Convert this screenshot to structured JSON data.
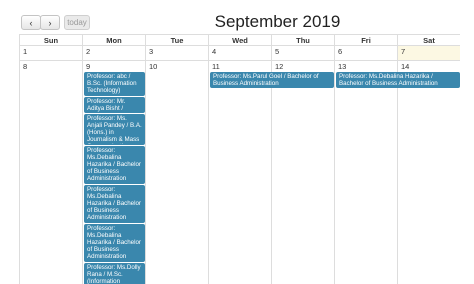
{
  "toolbar": {
    "prev_label": "‹",
    "next_label": "›",
    "today_label": "today",
    "title": "September 2019"
  },
  "weekdays": [
    "Sun",
    "Mon",
    "Tue",
    "Wed",
    "Thu",
    "Fri",
    "Sat"
  ],
  "week1": [
    "1",
    "2",
    "3",
    "4",
    "5",
    "6",
    "7"
  ],
  "week2": [
    "8",
    "9",
    "10",
    "11",
    "12",
    "13",
    "14"
  ],
  "events": {
    "mon": [
      "Professor: abc / B.Sc. (Information Technology)",
      "Professor: Mr. Aditya Bisht / B.H.M.",
      "Professor: Ms. Anjali Pandey / B.A. (Hons.) in Journalism & Mass Communication",
      "Professor: Ms.Debalina Hazarika / Bachelor of Business Administration",
      "Professor: Ms.Debalina Hazarika / Bachelor of Business Administration",
      "Professor: Ms.Debalina Hazarika / Bachelor of Business Administration",
      "Professor: Ms.Dolly Rana / M.Sc. (Information"
    ],
    "thu": "Professor: Ms.Parul Goel / Bachelor of Business Administration",
    "sat": "Professor: Ms.Debalina Hazarika / Bachelor of Business Administration"
  },
  "colors": {
    "event_bg": "#3a87ad",
    "today_bg": "#fcf8e3",
    "grid_line": "#dddddd"
  }
}
